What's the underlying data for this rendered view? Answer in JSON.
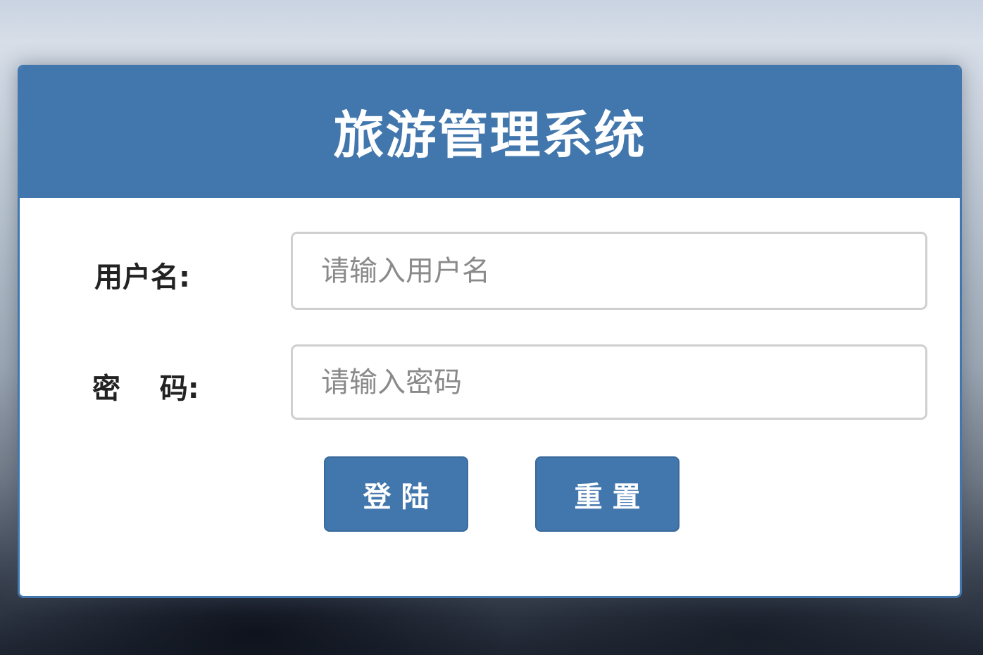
{
  "login": {
    "title": "旅游管理系统",
    "username": {
      "label": "用户名:",
      "placeholder": "请输入用户名",
      "value": ""
    },
    "password": {
      "label": "密    码:",
      "placeholder": "请输入密码",
      "value": ""
    },
    "buttons": {
      "login_label": "登 陆",
      "reset_label": "重 置"
    }
  },
  "colors": {
    "primary": "#4277ad",
    "card_background": "#ffffff",
    "input_border": "#cfcfcf",
    "placeholder": "#8a8a8a",
    "label_text": "#222222"
  }
}
